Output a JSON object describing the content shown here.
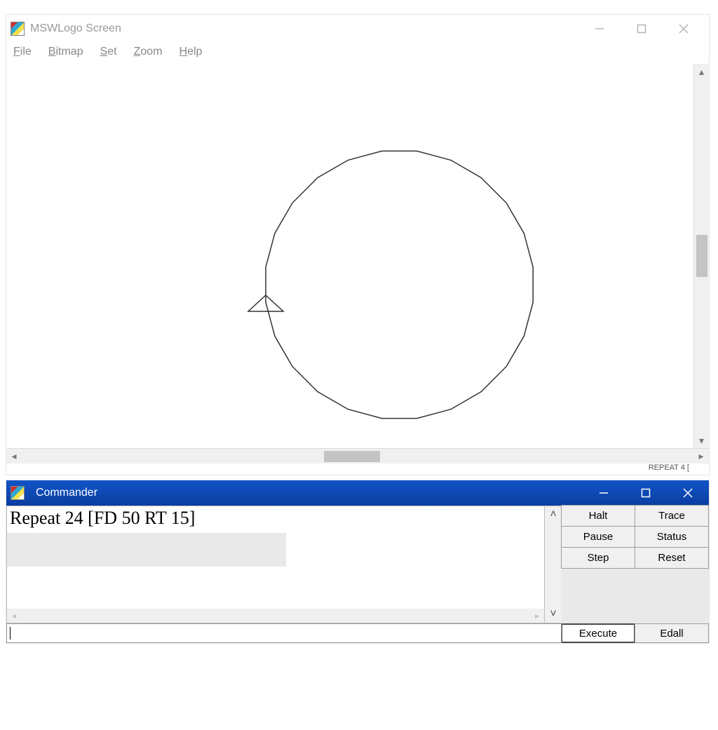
{
  "main_window": {
    "title": "MSWLogo Screen"
  },
  "menubar": {
    "items": [
      {
        "mnemonic": "F",
        "rest": "ile"
      },
      {
        "mnemonic": "B",
        "rest": "itmap"
      },
      {
        "mnemonic": "S",
        "rest": "et"
      },
      {
        "mnemonic": "Z",
        "rest": "oom"
      },
      {
        "mnemonic": "H",
        "rest": "elp"
      }
    ]
  },
  "truncated_label": "REPEAT 4 [",
  "commander": {
    "title": "Commander",
    "history_text": "Repeat 24 [FD 50 RT 15]",
    "input_value": "",
    "buttons": {
      "halt": "Halt",
      "trace": "Trace",
      "pause": "Pause",
      "status": "Status",
      "step": "Step",
      "reset": "Reset",
      "execute": "Execute",
      "edall": "Edall"
    }
  },
  "turtle": {
    "command": "REPEAT 24 [FD 50 RT 15]",
    "step_length": 50,
    "turn_degrees": 15,
    "repeats": 24,
    "resulting_shape": "24-gon (visually a circle)"
  }
}
